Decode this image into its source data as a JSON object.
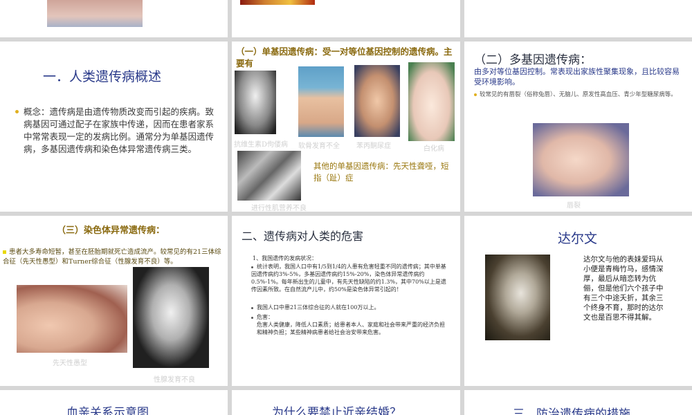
{
  "s1": {
    "title": "一．人类遗传病概述",
    "text": "概念：遗传病是由遗传物质改变而引起的疾病。致病基因可通过配子在家族中传递，因而在患者家系中常常表现一定的发病比例。通常分为单基因遗传病，多基因遗传病和染色体异常遗传病三类。"
  },
  "s2": {
    "heading": "（一）单基因遗传病：受一对等位基因控制的遗传病。主要有",
    "captions": [
      "抗维生素D佝偻病",
      "软骨发育不全",
      "苯丙酮尿症",
      "白化病",
      "进行性肌营养不良"
    ],
    "other": "其他的单基因遗传病：先天性聋哑，短指（趾）症"
  },
  "s3": {
    "heading": "（二）多基因遗传病：",
    "line": "由多对等位基因控制。常表现出家族性聚集现象，且比较容易受环境影响。",
    "bullet": "较常见的有唇裂（俗称兔唇）、无脑儿、原发性高血压、青少年型糖尿病等。",
    "caption": "唇裂"
  },
  "s4": {
    "heading": "（三）染色体异常遗传病：",
    "text": "患者大多寿命短暂，甚至在胚胎期就死亡造成流产。较常见的有21三体综合征（先天性愚型）和Turner综合征（性腺发育不良）等。",
    "captions": [
      "先天性愚型",
      "性腺发育不良"
    ]
  },
  "s5": {
    "title": "二、遗传病对人类的危害",
    "item1": "1、我国遗传的发病状况：",
    "b1": "统计表明，我国人口中有1/5到1/4的人患有危害轻重不同的遗传病；其中单基因遗传病约3%-5%，多基因遗传病约15%-20%，染色体异常遗传病约0.5%-1%。每年新出生的儿童中，有先天性缺陷的约1.3%，其中70%以上是遗传因素所致。在自然流产儿中，约50%是染色体异常引起的！",
    "b2": "我国人口中患21三体综合征的人就在100万以上。",
    "b3": "危害：",
    "b3b": "危害人类健康，降低人口素质；给患者本人、家庭和社会带来严重的经济负担和精神负担；某些精神病患者给社会治安带来危害。"
  },
  "s6": {
    "title": "达尔文",
    "text": "达尔文与他的表妹爱玛从小便是青梅竹马，感情深厚，最后从暗恋转为伉俪，但是他们六个孩子中有三个中途夭折，其余三个终身不育，那时的达尔文也是百思不得其解。"
  },
  "s7": {
    "title": "血亲关系示意图"
  },
  "s8": {
    "title": "为什么要禁止近亲结婚？"
  },
  "s9": {
    "title": "三、防治遗传病的措施"
  },
  "colors": {
    "background": "#d6d6d6",
    "title_blue": "#2a3a8a",
    "heading_brown": "#8a6a10",
    "bullet_yellow": "#e0b020"
  }
}
